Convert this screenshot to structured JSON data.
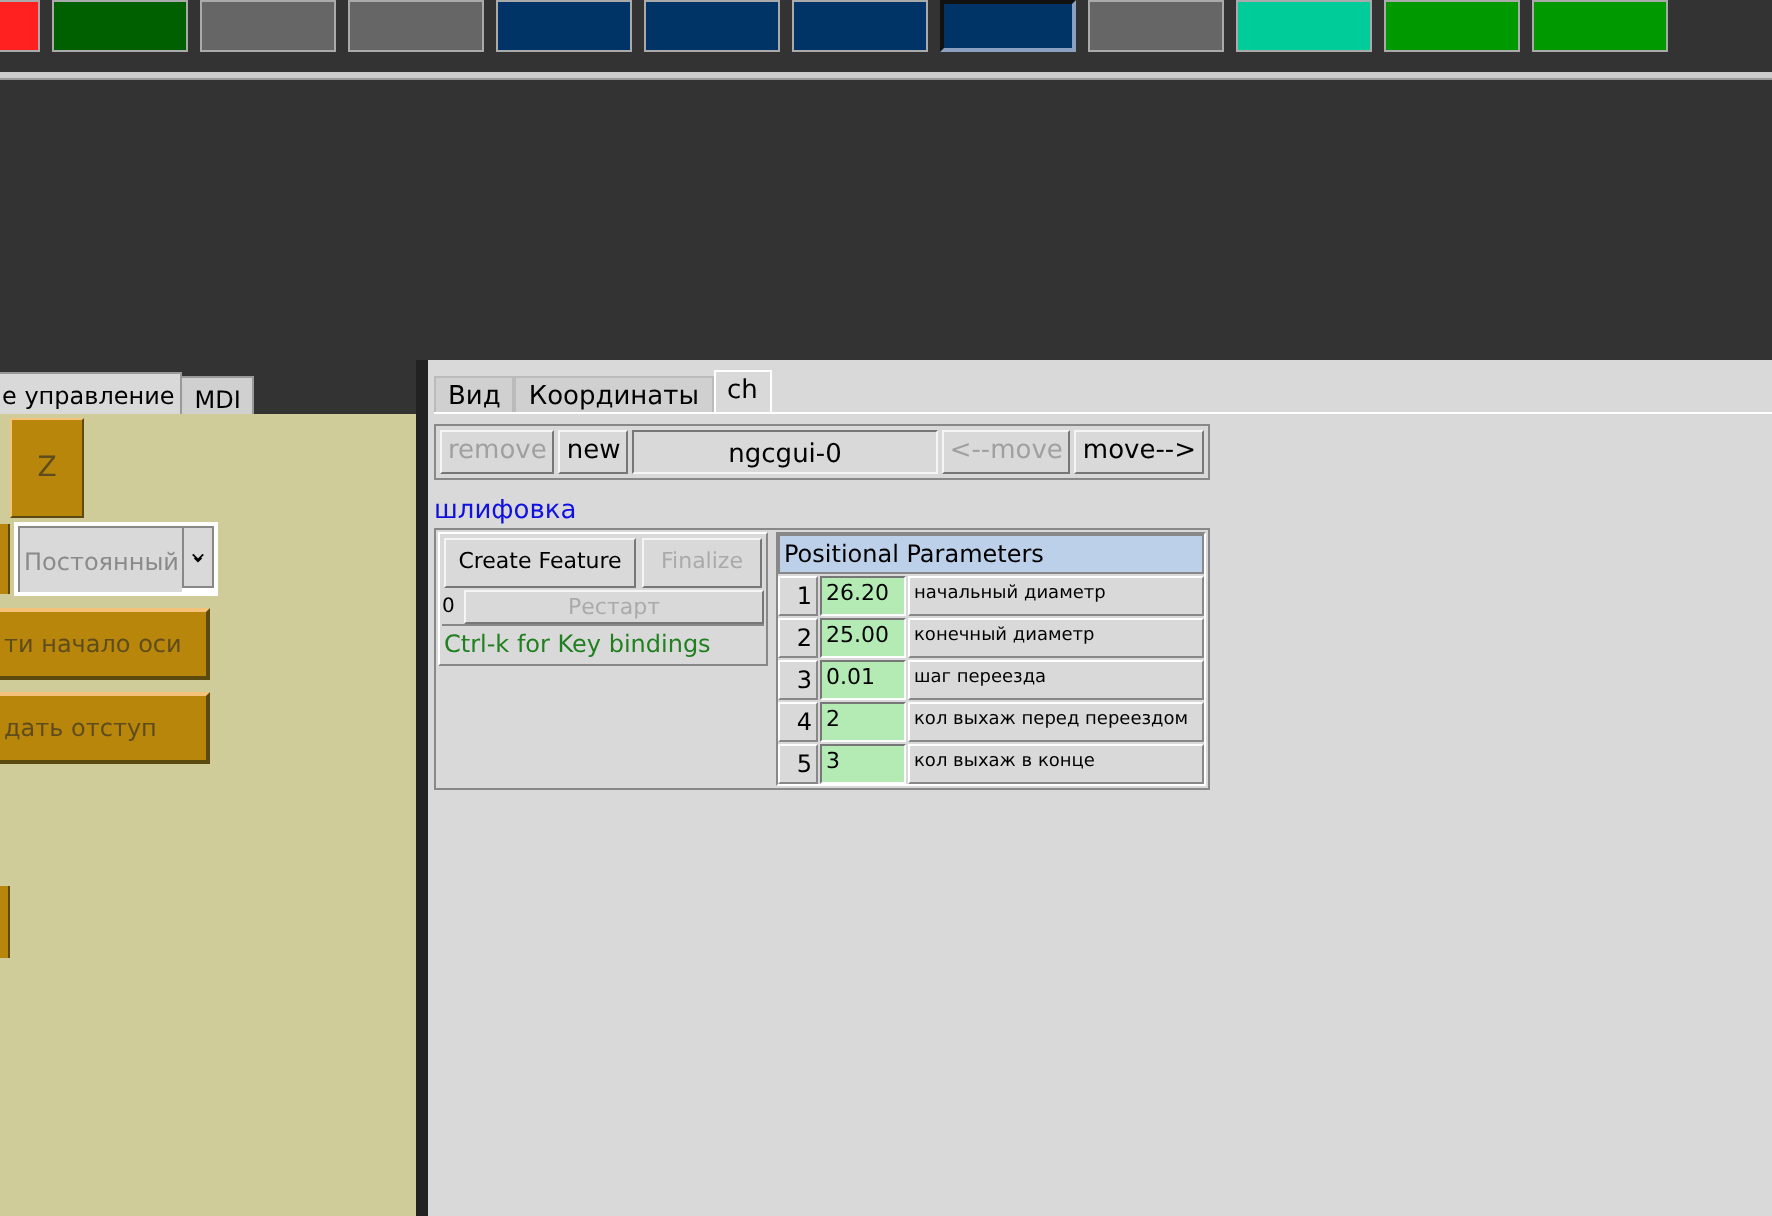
{
  "top_buttons": [
    {
      "color": "#ff2020",
      "pressed": false
    },
    {
      "color": "#006000",
      "pressed": false
    },
    {
      "color": "#666666",
      "pressed": false
    },
    {
      "color": "#666666",
      "pressed": false
    },
    {
      "color": "#003366",
      "pressed": false
    },
    {
      "color": "#003366",
      "pressed": false
    },
    {
      "color": "#003366",
      "pressed": false
    },
    {
      "color": "#003366",
      "pressed": true
    },
    {
      "color": "#666666",
      "pressed": false
    },
    {
      "color": "#00cc99",
      "pressed": false
    },
    {
      "color": "#009900",
      "pressed": false
    },
    {
      "color": "#009900",
      "pressed": false
    }
  ],
  "left_panel": {
    "tabs": [
      {
        "label": "е управление",
        "selected": true
      },
      {
        "label": "MDI",
        "selected": false
      }
    ],
    "axis_button": {
      "label": "Z",
      "disabled": true
    },
    "mode_select": {
      "value": "Постоянный",
      "disabled": true
    },
    "buttons": [
      {
        "label": "ти начало оси",
        "disabled": true
      },
      {
        "label": "дать отступ",
        "disabled": true
      }
    ]
  },
  "right_panel": {
    "tabs": [
      {
        "label": "Вид",
        "selected": false
      },
      {
        "label": "Координаты",
        "selected": false
      },
      {
        "label": "ch",
        "selected": true
      }
    ],
    "toolbar": [
      {
        "kind": "button",
        "label": "remove",
        "disabled": true
      },
      {
        "kind": "button",
        "label": "new",
        "disabled": false
      },
      {
        "kind": "name",
        "label": "ngcgui-0",
        "disabled": false
      },
      {
        "kind": "button",
        "label": "<--move",
        "disabled": true
      },
      {
        "kind": "button",
        "label": "move-->",
        "disabled": false
      }
    ],
    "subroutine_title": "шлифовка",
    "create_feature": {
      "label": "Create Feature",
      "disabled": false
    },
    "finalize": {
      "label": "Finalize",
      "disabled": true
    },
    "restart_count": "0",
    "restart": {
      "label": "Рестарт",
      "disabled": true
    },
    "key_hint": "Ctrl-k for Key bindings",
    "params_title": "Positional Parameters",
    "params": [
      {
        "index": "1",
        "value": "26.20",
        "label": "начальный диаметр"
      },
      {
        "index": "2",
        "value": "25.00",
        "label": "конечный диаметр"
      },
      {
        "index": "3",
        "value": "0.01",
        "label": "шаг переезда"
      },
      {
        "index": "4",
        "value": "2",
        "label": "кол выхаж перед переездом"
      },
      {
        "index": "5",
        "value": "3",
        "label": "кол выхаж в конце"
      }
    ]
  }
}
